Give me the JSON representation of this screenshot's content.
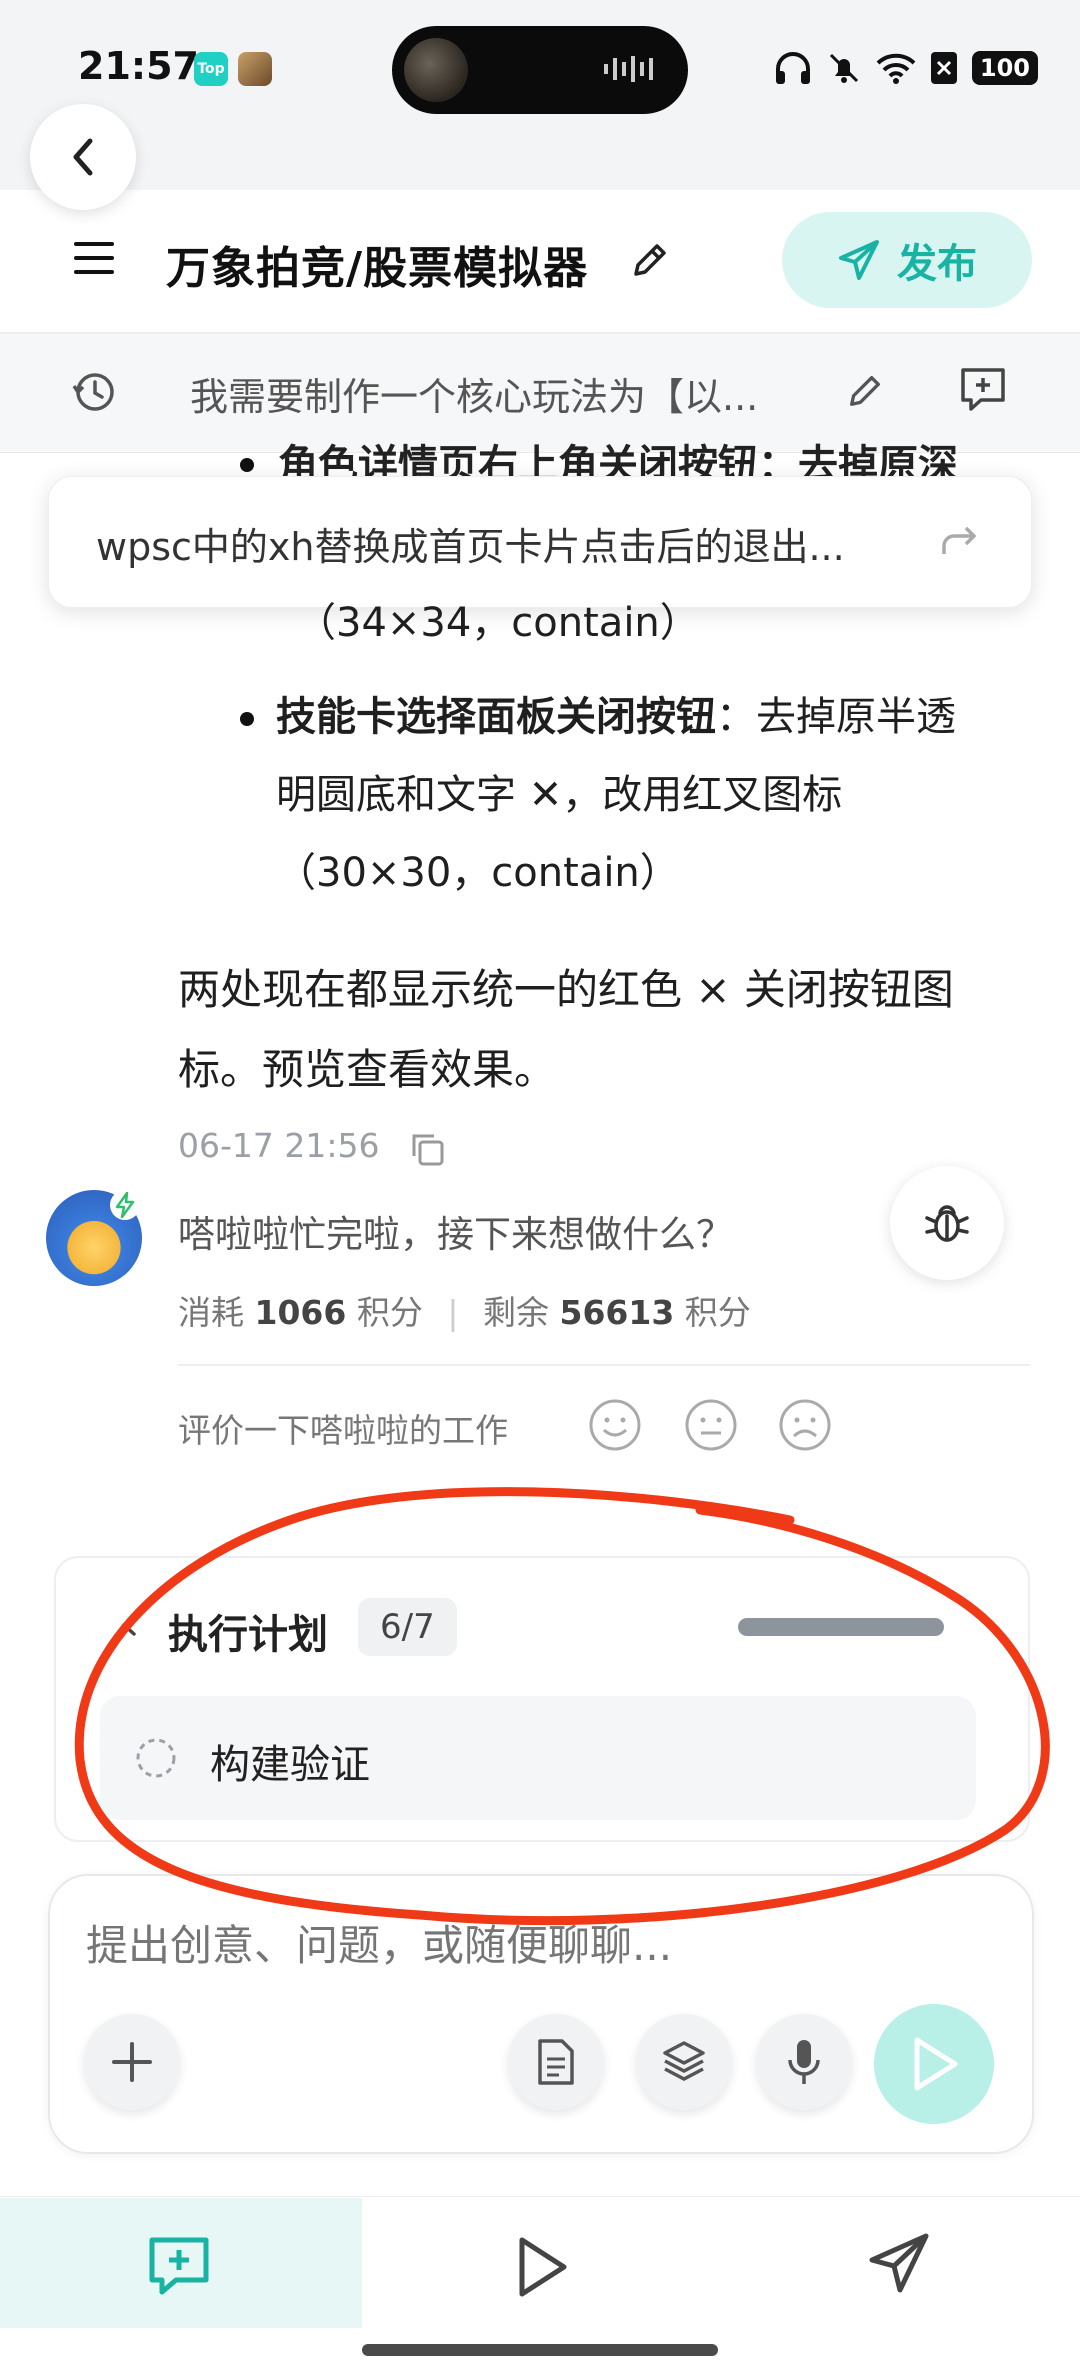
{
  "status_bar": {
    "time": "21:57",
    "app_badge": "Top",
    "battery": "100"
  },
  "header": {
    "title": "万象拍竞/股票模拟器",
    "publish_label": "发布"
  },
  "prompt_bar": {
    "text": "我需要制作一个核心玩法为【以..."
  },
  "floating_suggestion": {
    "text": "wpsc中的xh替换成首页卡片点击后的退出..."
  },
  "content": {
    "cut_heading": "角色详情页右上角关闭按钮：去掉原深",
    "bullet1_tail": "（34×34，contain）",
    "bullet2_bold": "技能卡选择面板关闭按钮",
    "bullet2_rest": "：去掉原半透",
    "bullet2_line2": "明圆底和文字 ✕，改用红叉图标",
    "bullet2_line3": "（30×30，contain）",
    "paragraph": "两处现在都显示统一的红色 × 关闭按钮图标。预览查看效果。",
    "timestamp": "06-17 21:56",
    "assistant_message": "嗒啦啦忙完啦，接下来想做什么？",
    "credits_used_label": "消耗",
    "credits_used_value": "1066",
    "credits_unit": "积分",
    "credits_remaining_label": "剩余",
    "credits_remaining_value": "56613",
    "rate_label": "评价一下嗒啦啦的工作"
  },
  "plan": {
    "title": "执行计划",
    "progress_text": "6/7",
    "progress_fraction": 0.857,
    "items": [
      {
        "label": "构建验证",
        "status": "pending"
      }
    ]
  },
  "input": {
    "placeholder": "提出创意、问题，或随便聊聊..."
  },
  "bottom_nav": {
    "items": [
      {
        "icon": "chat-plus-icon",
        "active": true
      },
      {
        "icon": "play-icon",
        "active": false
      },
      {
        "icon": "send-icon",
        "active": false
      }
    ]
  },
  "colors": {
    "accent": "#19b3a4",
    "accent_light": "#d9f5f2",
    "annotation_red": "#f03a17"
  }
}
